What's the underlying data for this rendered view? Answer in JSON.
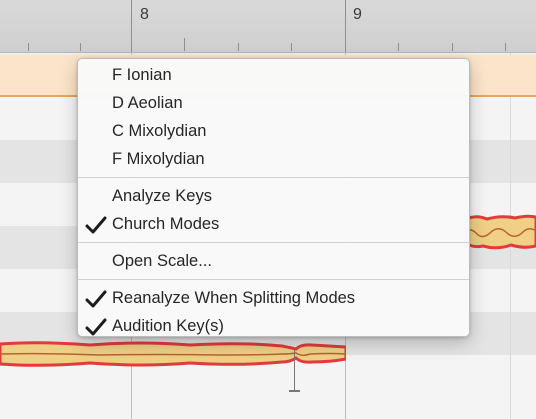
{
  "ruler": {
    "bar_8": "8",
    "bar_9": "9"
  },
  "menu": {
    "sections": [
      {
        "items": [
          {
            "label": "F Ionian",
            "checked": false
          },
          {
            "label": "D Aeolian",
            "checked": false
          },
          {
            "label": "C Mixolydian",
            "checked": false
          },
          {
            "label": "F Mixolydian",
            "checked": false
          }
        ]
      },
      {
        "items": [
          {
            "label": "Analyze Keys",
            "checked": false
          },
          {
            "label": "Church Modes",
            "checked": true
          }
        ]
      },
      {
        "items": [
          {
            "label": "Open Scale...",
            "checked": false
          }
        ]
      },
      {
        "items": [
          {
            "label": "Reanalyze When Splitting Modes",
            "checked": true
          },
          {
            "label": "Audition Key(s)",
            "checked": true
          }
        ]
      }
    ]
  },
  "colors": {
    "blob_fill": "#f0cf86",
    "blob_outline": "#e23b3b",
    "pitch_line": "#b8642d",
    "region_band": "#fbe4c9",
    "region_band_border": "#e7a463"
  }
}
